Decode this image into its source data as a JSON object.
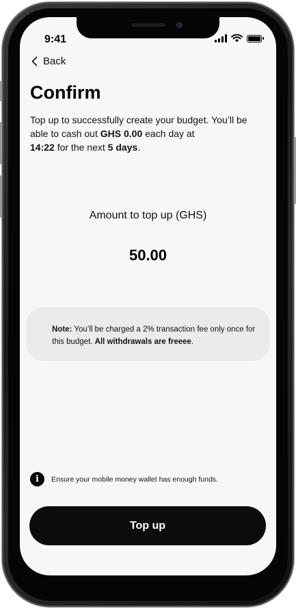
{
  "status_bar": {
    "time": "9:41",
    "icons": [
      "signal-icon",
      "wifi-icon",
      "battery-icon"
    ]
  },
  "nav": {
    "back_label": "Back"
  },
  "page": {
    "title": "Confirm",
    "description": {
      "part1": "Top up to successfully create your budget. You’ll be able to cash out ",
      "cashout_amount": "GHS 0.00",
      "part2": " each day at ",
      "time": "14:22",
      "part3": " for the next ",
      "duration": "5 days",
      "part4": "."
    }
  },
  "amount": {
    "label": "Amount to top up (GHS)",
    "value": "50.00"
  },
  "note": {
    "prefix": "Note:",
    "text": " You’ll be charged a 2% transaction fee only once for this budget. ",
    "emphasis": "All withdrawals are freeee",
    "suffix": "."
  },
  "info": {
    "icon": "info-icon",
    "text": "Ensure your mobile money wallet has enough funds."
  },
  "actions": {
    "topup_label": "Top up"
  },
  "colors": {
    "screen_bg": "#f7f7f7",
    "note_bg": "#ebebeb",
    "button_bg": "#0c0c0c",
    "button_text": "#ffffff",
    "text": "#111111"
  }
}
